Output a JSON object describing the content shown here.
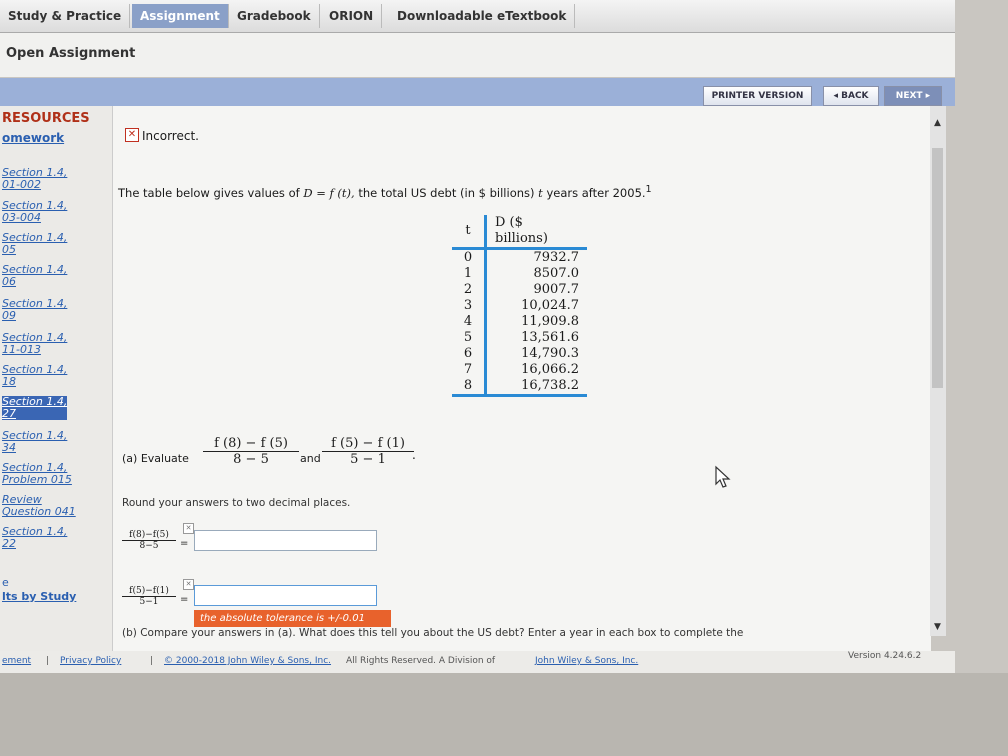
{
  "nav": {
    "tabs": [
      "Study & Practice",
      "Assignment",
      "Gradebook",
      "ORION",
      "Downloadable eTextbook"
    ],
    "active_tab": "Assignment"
  },
  "subheader": {
    "title": "Open Assignment"
  },
  "toolbar": {
    "printer": "PRINTER VERSION",
    "back": "◂ BACK",
    "next": "NEXT ▸"
  },
  "sidebar": {
    "resources": "RESOURCES",
    "homework": "omework",
    "items": [
      {
        "line1": "Section 1.4,",
        "line2": "01-002"
      },
      {
        "line1": "Section 1.4,",
        "line2": "03-004"
      },
      {
        "line1": "Section 1.4,",
        "line2": "05"
      },
      {
        "line1": "Section 1.4,",
        "line2": "06"
      },
      {
        "line1": "Section 1.4,",
        "line2": "09"
      },
      {
        "line1": "Section 1.4,",
        "line2": "11-013"
      },
      {
        "line1": "Section 1.4,",
        "line2": "18"
      },
      {
        "line1": "Section 1.4,",
        "line2": "27"
      },
      {
        "line1": "Section 1.4,",
        "line2": "34"
      },
      {
        "line1": "Section 1.4,",
        "line2": "Problem 015"
      },
      {
        "line1": "Review",
        "line2": "Question 041"
      },
      {
        "line1": "Section 1.4,",
        "line2": "22"
      }
    ],
    "selected_index": 7,
    "bottom_1": "e",
    "bottom_2": "lts by Study"
  },
  "question": {
    "status_icon": "x-icon",
    "status": "Incorrect.",
    "statement_prefix": "The table below gives values of",
    "statement_math": "D = f (t),",
    "statement_mid": "the total US debt (in $ billions)",
    "statement_var": "t",
    "statement_suffix": "years after 2005.",
    "footnote": "1",
    "table": {
      "header_t": "t",
      "header_d": "D ($ billions)",
      "rows": [
        {
          "t": "0",
          "d": "7932.7"
        },
        {
          "t": "1",
          "d": "8507.0"
        },
        {
          "t": "2",
          "d": "9007.7"
        },
        {
          "t": "3",
          "d": "10,024.7"
        },
        {
          "t": "4",
          "d": "11,909.8"
        },
        {
          "t": "5",
          "d": "13,561.6"
        },
        {
          "t": "6",
          "d": "14,790.3"
        },
        {
          "t": "7",
          "d": "16,066.2"
        },
        {
          "t": "8",
          "d": "16,738.2"
        }
      ]
    },
    "part_a_label": "(a) Evaluate",
    "frac1_num": "f (8) − f (5)",
    "frac1_den": "8 − 5",
    "and": "and",
    "frac2_num": "f (5) − f (1)",
    "frac2_den": "5 − 1",
    "period": ".",
    "round_note": "Round your answers to two decimal places.",
    "ans1_num": "f(8)−f(5)",
    "ans1_den": "8−5",
    "ans2_num": "f(5)−f(1)",
    "ans2_den": "5−1",
    "equals": "=",
    "ans1_value": "",
    "ans2_value": "",
    "tolerance": "the absolute tolerance is +/-0.01",
    "part_b": "(b) Compare your answers in (a). What does this tell you about the US debt? Enter a year in each box to complete the"
  },
  "footer": {
    "left": "ement",
    "privacy": "Privacy Policy",
    "copyright": "© 2000-2018 John Wiley & Sons, Inc.",
    "rights": "All Rights Reserved. A Division of",
    "company": "John Wiley & Sons, Inc.",
    "version": "Version 4.24.6.2"
  },
  "colors": {
    "nav_active": "#8aa0c8",
    "accent_blue": "#2a8ad4",
    "error": "#c03020",
    "tolerance_bg": "#e8622c"
  }
}
